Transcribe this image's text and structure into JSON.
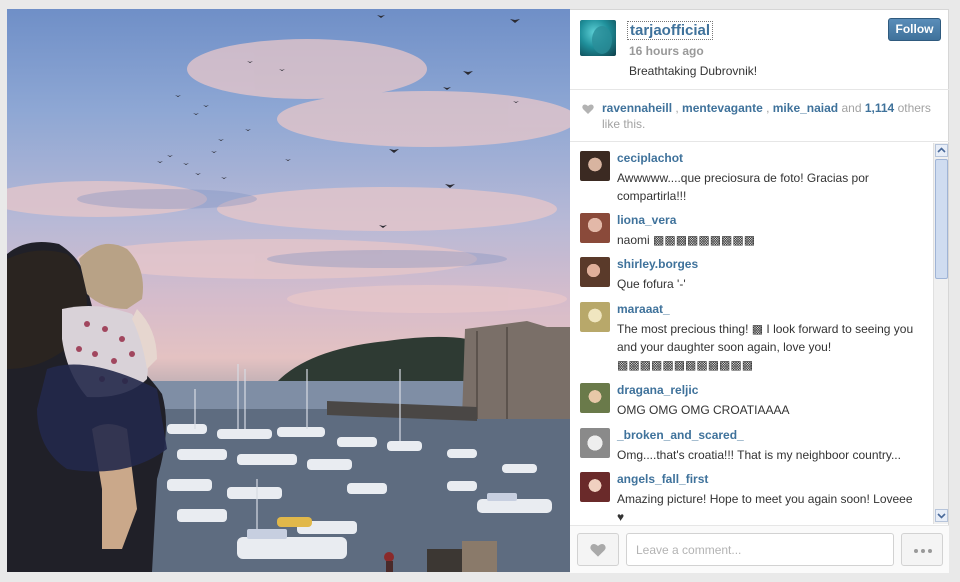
{
  "post": {
    "username": "tarjaofficial",
    "time_ago": "16 hours ago",
    "caption": "Breathtaking Dubrovnik!",
    "follow_label": "Follow"
  },
  "likes": {
    "users": [
      "ravennaheill",
      "mentevagante",
      "mike_naiad"
    ],
    "and_text": "and",
    "count": "1,114",
    "suffix": "others like this."
  },
  "comments": [
    {
      "user": "ceciplachot",
      "text": "Awwwww....que preciosura de foto! Gracias por compartirla!!!",
      "avatar_color": "#5a4a3a"
    },
    {
      "user": "liona_vera",
      "text": "naomi ▩▩▩▩▩▩▩▩▩",
      "avatar_color": "#a0614a"
    },
    {
      "user": "shirley.borges",
      "text": "Que fofura '-'",
      "avatar_color": "#6b4b3a"
    },
    {
      "user": "maraaat_",
      "text": "The most precious thing! ▩ I look forward to seeing you and your daughter soon again, love you! ▩▩▩▩▩▩▩▩▩▩▩▩",
      "avatar_color": "#b5a86a"
    },
    {
      "user": "dragana_reljic",
      "text": "OMG OMG OMG CROATIAAAA",
      "avatar_color": "#7a8a5a"
    },
    {
      "user": "_broken_and_scared_",
      "text": "Omg....that's croatia!!! That is my neighboor country...",
      "avatar_color": "#8a8a8a"
    },
    {
      "user": "angels_fall_first",
      "text": "Amazing picture! Hope to meet you again soon! Loveee ♥",
      "avatar_color": "#7a4a3a"
    }
  ],
  "footer": {
    "comment_placeholder": "Leave a comment..."
  },
  "colors": {
    "link_blue": "#3f729b",
    "follow_bg": "#3f729b"
  }
}
